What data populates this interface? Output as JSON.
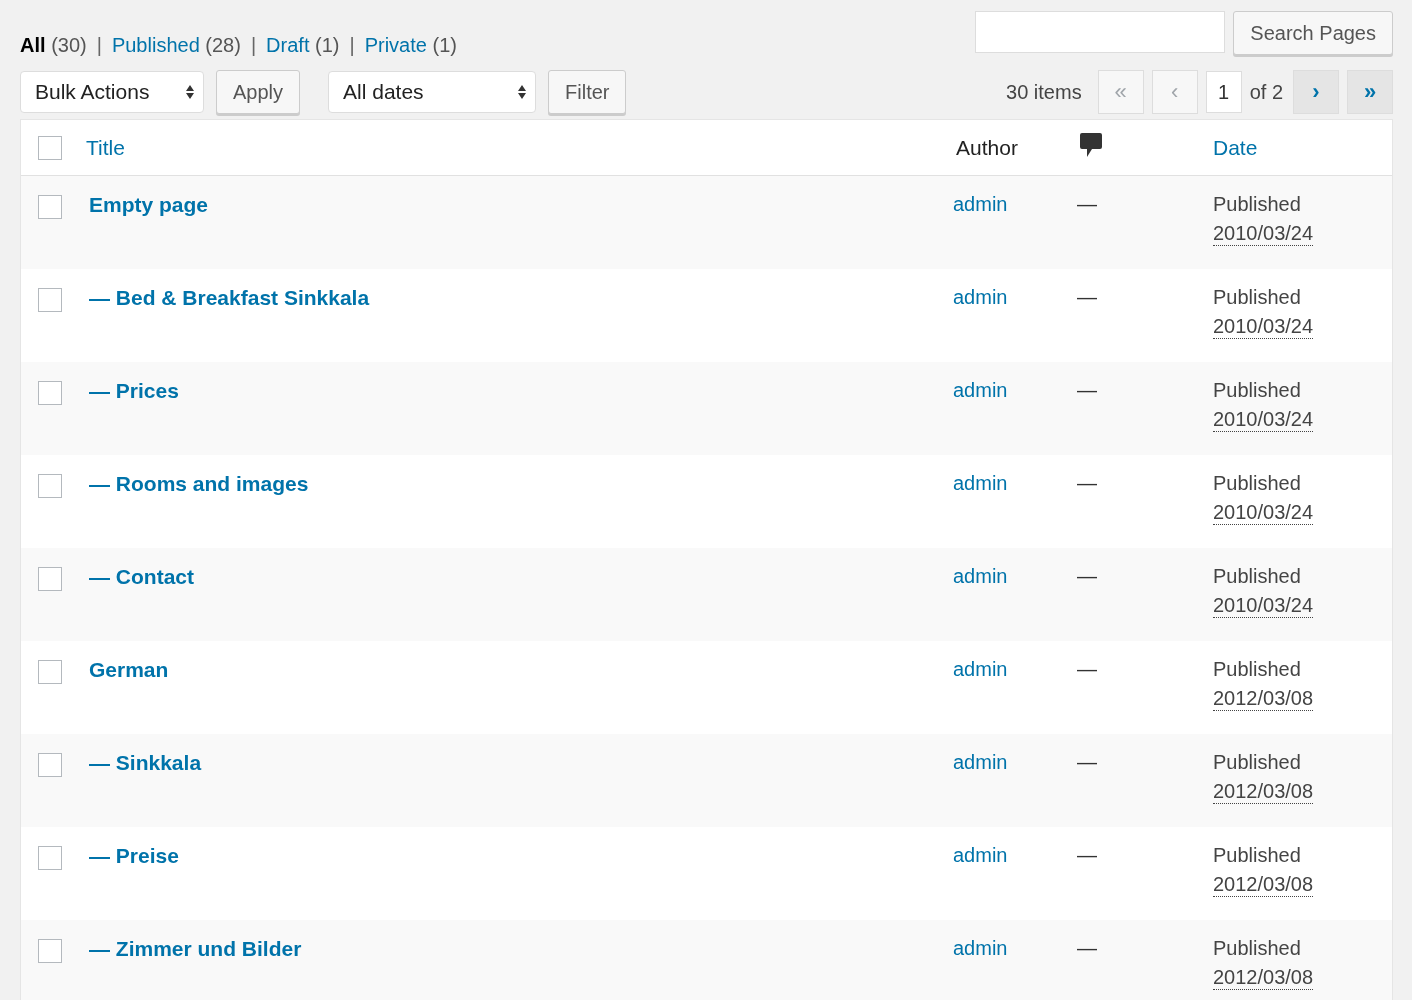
{
  "filters": [
    {
      "label": "All",
      "count": "(30)",
      "selected": true,
      "separator": "|"
    },
    {
      "label": "Published",
      "count": "(28)",
      "selected": false,
      "separator": "|"
    },
    {
      "label": "Draft",
      "count": "(1)",
      "selected": false,
      "separator": "|"
    },
    {
      "label": "Private",
      "count": "(1)",
      "selected": false
    }
  ],
  "search": {
    "button": "Search Pages"
  },
  "bulk_actions": {
    "value": "Bulk Actions",
    "button": "Apply"
  },
  "date_filter": {
    "value": "All dates",
    "button": "Filter"
  },
  "pagination": {
    "count": "30 items",
    "before": [
      {
        "label": "«",
        "disabled": true
      },
      {
        "label": "‹",
        "disabled": true
      }
    ],
    "current": "1",
    "of": "of 2",
    "after": [
      {
        "label": "›",
        "disabled": false
      },
      {
        "label": "»",
        "disabled": false
      }
    ]
  },
  "table": {
    "select_all_checked": false,
    "columns": [
      {
        "label": "Title",
        "sortable": true
      },
      {
        "label": "Author",
        "sortable": false
      },
      {
        "label": "Date",
        "sortable": true
      }
    ],
    "rows": [
      {
        "checked": false,
        "title": "Empty page",
        "author": "admin",
        "comments": "—",
        "status": "Published",
        "date": "2010/03/24"
      },
      {
        "checked": false,
        "title": "— Bed & Breakfast Sinkkala",
        "author": "admin",
        "comments": "—",
        "status": "Published",
        "date": "2010/03/24"
      },
      {
        "checked": false,
        "title": "— Prices",
        "author": "admin",
        "comments": "—",
        "status": "Published",
        "date": "2010/03/24"
      },
      {
        "checked": false,
        "title": "— Rooms and images",
        "author": "admin",
        "comments": "—",
        "status": "Published",
        "date": "2010/03/24"
      },
      {
        "checked": false,
        "title": "— Contact",
        "author": "admin",
        "comments": "—",
        "status": "Published",
        "date": "2010/03/24"
      },
      {
        "checked": false,
        "title": "German",
        "author": "admin",
        "comments": "—",
        "status": "Published",
        "date": "2012/03/08"
      },
      {
        "checked": false,
        "title": "— Sinkkala",
        "author": "admin",
        "comments": "—",
        "status": "Published",
        "date": "2012/03/08"
      },
      {
        "checked": false,
        "title": "— Preise",
        "author": "admin",
        "comments": "—",
        "status": "Published",
        "date": "2012/03/08"
      },
      {
        "checked": false,
        "title": "— Zimmer und Bilder",
        "author": "admin",
        "comments": "—",
        "status": "Published",
        "date": "2012/03/08"
      }
    ]
  }
}
